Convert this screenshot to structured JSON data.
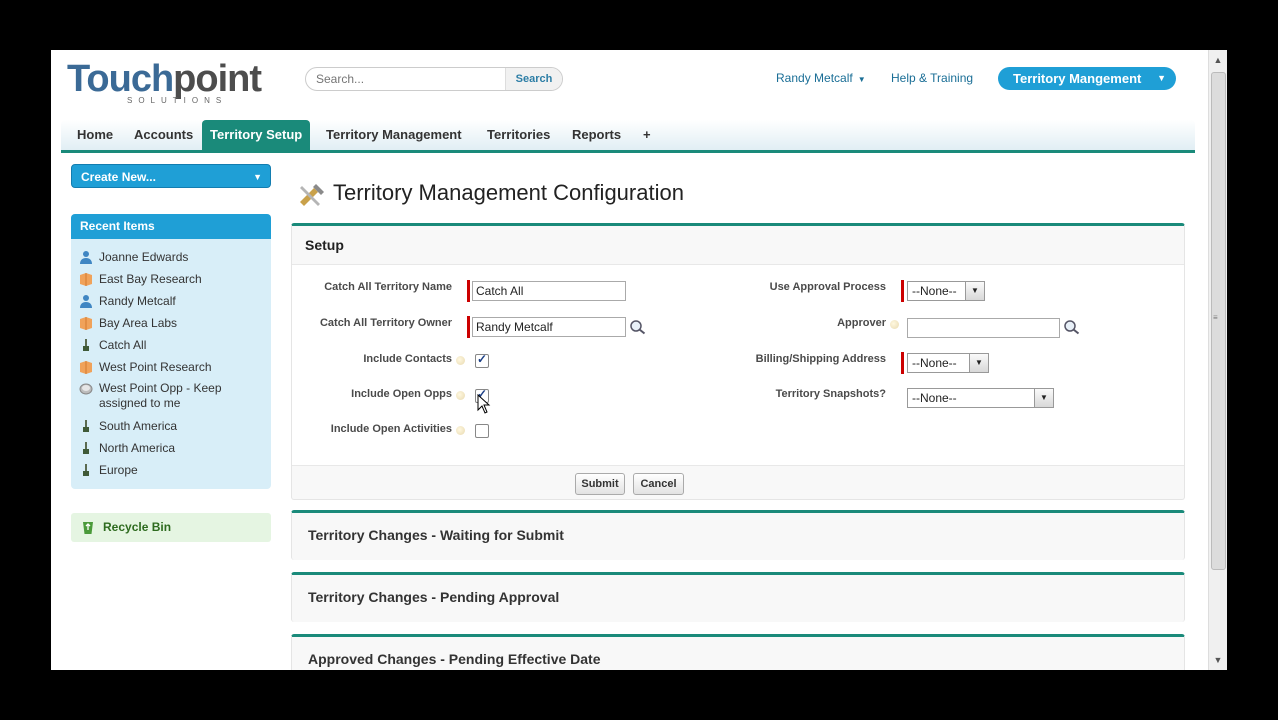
{
  "header": {
    "logo_text_a": "Touch",
    "logo_text_b": "point",
    "logo_sub": "SOLUTIONS",
    "search_placeholder": "Search...",
    "search_button": "Search",
    "user_name": "Randy Metcalf",
    "help_link": "Help & Training",
    "app_menu": "Territory Mangement"
  },
  "tabs": [
    {
      "label": "Home"
    },
    {
      "label": "Accounts"
    },
    {
      "label": "Territory Setup",
      "active": true
    },
    {
      "label": "Territory Management"
    },
    {
      "label": "Territories"
    },
    {
      "label": "Reports"
    },
    {
      "label": "+"
    }
  ],
  "sidebar": {
    "create_new": "Create New...",
    "recent_title": "Recent Items",
    "recent_items": [
      {
        "label": "Joanne Edwards",
        "icon": "person-icon"
      },
      {
        "label": "East Bay Research",
        "icon": "account-icon"
      },
      {
        "label": "Randy Metcalf",
        "icon": "person-icon"
      },
      {
        "label": "Bay Area Labs",
        "icon": "account-icon"
      },
      {
        "label": "Catch All",
        "icon": "territory-icon"
      },
      {
        "label": "West Point Research",
        "icon": "account-icon"
      },
      {
        "label": "West Point Opp - Keep assigned to me",
        "icon": "opportunity-icon"
      },
      {
        "label": "South America",
        "icon": "territory-icon"
      },
      {
        "label": "North America",
        "icon": "territory-icon"
      },
      {
        "label": "Europe",
        "icon": "territory-icon"
      }
    ],
    "recycle_bin": "Recycle Bin"
  },
  "main": {
    "page_title": "Territory Management Configuration",
    "setup": {
      "heading": "Setup",
      "catch_all_name_label": "Catch All Territory Name",
      "catch_all_name_value": "Catch All",
      "catch_all_owner_label": "Catch All Territory Owner",
      "catch_all_owner_value": "Randy Metcalf",
      "include_contacts_label": "Include Contacts",
      "include_contacts_checked": true,
      "include_open_opps_label": "Include Open Opps",
      "include_open_opps_checked": true,
      "include_open_activities_label": "Include Open Activities",
      "include_open_activities_checked": false,
      "use_approval_label": "Use Approval Process",
      "use_approval_value": "--None--",
      "approver_label": "Approver",
      "approver_value": "",
      "billing_label": "Billing/Shipping Address",
      "billing_value": "--None--",
      "snapshots_label": "Territory Snapshots?",
      "snapshots_value": "--None--",
      "submit_button": "Submit",
      "cancel_button": "Cancel"
    },
    "sections": [
      {
        "title": "Territory Changes - Waiting for Submit"
      },
      {
        "title": "Territory Changes - Pending Approval"
      },
      {
        "title": "Approved Changes - Pending Effective Date"
      }
    ]
  },
  "colors": {
    "accent_teal": "#1a8a7a",
    "brand_blue": "#1f9fd6",
    "link_blue": "#1a6e96",
    "required_red": "#cc0000"
  }
}
